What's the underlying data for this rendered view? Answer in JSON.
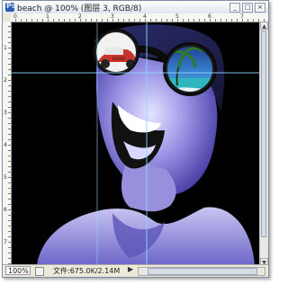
{
  "window": {
    "title": "beach @ 100% (图层 3, RGB/8)",
    "buttons": {
      "minimize": "_",
      "maximize": "□",
      "close": "×"
    }
  },
  "rulers": {
    "horizontal": [
      "0",
      "1",
      "2",
      "3",
      "4",
      "5",
      "6",
      "7"
    ],
    "vertical": [
      "1",
      "2",
      "3",
      "4",
      "5",
      "6",
      "7"
    ]
  },
  "status": {
    "zoom": "100%",
    "doc_info": "文件:675.0K/2.14M",
    "nav_arrow": "▶"
  },
  "colors": {
    "canvas_bg": "#000000",
    "face_tint": "#6b64c8",
    "guide": "#8fd6ff"
  }
}
